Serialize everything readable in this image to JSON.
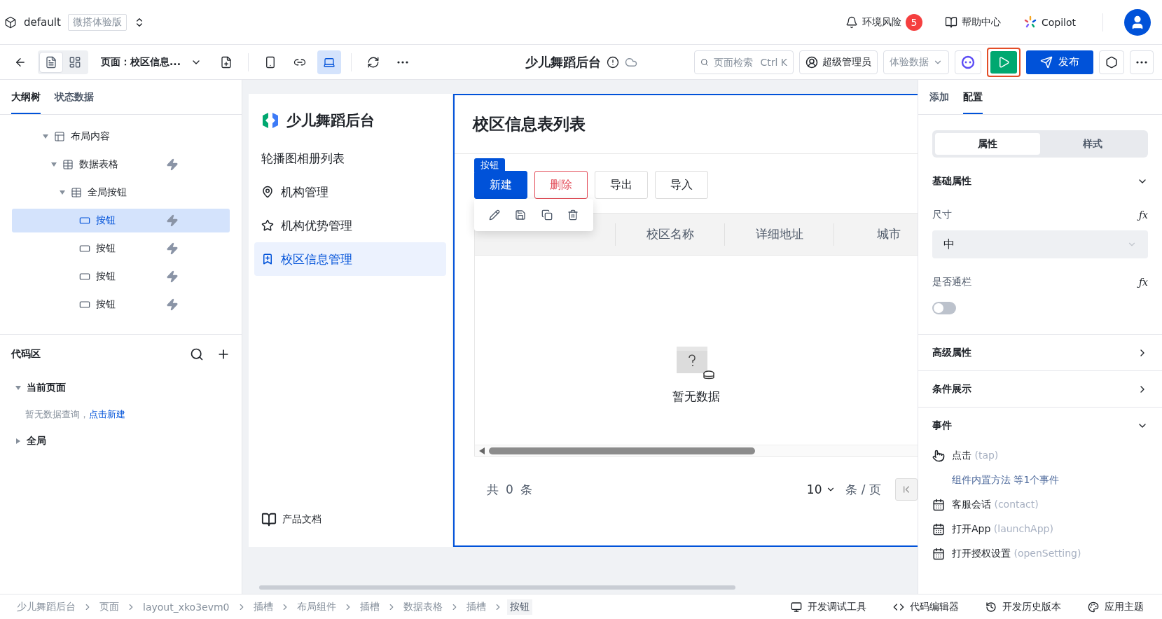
{
  "header": {
    "project": "default",
    "edition": "微搭体验版",
    "risk": {
      "label": "环境风险",
      "count": "5"
    },
    "help": "帮助中心",
    "copilot": "Copilot"
  },
  "toolbar": {
    "views": [
      {
        "kind": "page",
        "selected": true
      },
      {
        "kind": "layout",
        "selected": false
      }
    ],
    "page_select": "页面：校区信息...",
    "devices": [
      {
        "kind": "phone",
        "selected": false
      },
      {
        "kind": "miniprogram",
        "selected": false
      },
      {
        "kind": "desktop",
        "selected": true
      }
    ],
    "app_title": "少儿舞蹈后台",
    "search": {
      "placeholder": "页面检索",
      "shortcut": "Ctrl K"
    },
    "role": "超级管理员",
    "data_source": "体验数据",
    "publish": "发布"
  },
  "left_panel": {
    "tabs": [
      {
        "label": "大纲树",
        "selected": true
      },
      {
        "label": "状态数据",
        "selected": false
      }
    ],
    "tree": [
      {
        "label": "布局内容",
        "kind": "layout",
        "bolt": false,
        "selected": false,
        "expanded": true,
        "children": [
          {
            "label": "数据表格",
            "kind": "table",
            "bolt": true,
            "selected": false,
            "expanded": true,
            "children": [
              {
                "label": "全局按钮",
                "kind": "table",
                "bolt": false,
                "selected": false,
                "expanded": true,
                "children": [
                  {
                    "label": "按钮",
                    "kind": "button",
                    "bolt": true,
                    "selected": true
                  },
                  {
                    "label": "按钮",
                    "kind": "button",
                    "bolt": true,
                    "selected": false
                  },
                  {
                    "label": "按钮",
                    "kind": "button",
                    "bolt": true,
                    "selected": false
                  },
                  {
                    "label": "按钮",
                    "kind": "button",
                    "bolt": true,
                    "selected": false
                  }
                ]
              }
            ]
          }
        ]
      }
    ],
    "code_area": {
      "title": "代码区",
      "groups": [
        {
          "label": "当前页面",
          "expanded": true,
          "empty_text": "暂无数据查询，",
          "empty_link": "点击新建"
        },
        {
          "label": "全局",
          "expanded": false
        }
      ]
    }
  },
  "canvas": {
    "app_name": "少儿舞蹈后台",
    "nav": [
      {
        "label": "轮播图相册列表",
        "kind": "plain",
        "selected": false
      },
      {
        "label": "机构管理",
        "kind": "map",
        "selected": false
      },
      {
        "label": "机构优势管理",
        "kind": "star",
        "selected": false
      },
      {
        "label": "校区信息管理",
        "kind": "bookmark",
        "selected": true
      }
    ],
    "docs": "产品文档",
    "page_title": "校区信息表列表",
    "selection_tag": "按钮",
    "buttons": [
      {
        "label": "新建",
        "kind": "primary"
      },
      {
        "label": "删除",
        "kind": "danger"
      },
      {
        "label": "导出",
        "kind": "default"
      },
      {
        "label": "导入",
        "kind": "default"
      }
    ],
    "columns": [
      "校区名称",
      "详细地址",
      "城市"
    ],
    "empty": "暂无数据",
    "pagination": {
      "total_prefix": "共",
      "total": "0",
      "total_suffix": "条",
      "page_size": "10",
      "page_size_unit": "条 / 页"
    }
  },
  "right_panel": {
    "tabs": [
      {
        "label": "添加",
        "selected": false
      },
      {
        "label": "配置",
        "selected": true
      }
    ],
    "segments": [
      {
        "label": "属性",
        "selected": true
      },
      {
        "label": "样式",
        "selected": false
      }
    ],
    "sections": [
      {
        "title": "基础属性",
        "expanded": true
      },
      {
        "title": "高级属性",
        "expanded": false
      },
      {
        "title": "条件展示",
        "expanded": false
      },
      {
        "title": "事件",
        "expanded": true
      }
    ],
    "size": {
      "label": "尺寸",
      "formula": "ƒx",
      "value": "中"
    },
    "full_width": {
      "label": "是否通栏",
      "formula": "ƒx",
      "on": false
    },
    "events": [
      {
        "kind": "pointer",
        "name": "点击",
        "code": "(tap)",
        "detail": "组件内置方法 等1个事件"
      },
      {
        "kind": "calendar",
        "name": "客服会话",
        "code": "(contact)"
      },
      {
        "kind": "calendar",
        "name": "打开App",
        "code": "(launchApp)"
      },
      {
        "kind": "calendar",
        "name": "打开授权设置",
        "code": "(openSetting)"
      }
    ]
  },
  "status_bar": {
    "breadcrumbs": [
      "少儿舞蹈后台",
      "页面",
      "layout_xko3evm0",
      "插槽",
      "布局组件",
      "插槽",
      "数据表格",
      "插槽",
      "按钮"
    ],
    "tools": [
      {
        "kind": "debug",
        "label": "开发调试工具"
      },
      {
        "kind": "code",
        "label": "代码编辑器"
      },
      {
        "kind": "history",
        "label": "开发历史版本"
      },
      {
        "kind": "theme",
        "label": "应用主题"
      }
    ]
  }
}
